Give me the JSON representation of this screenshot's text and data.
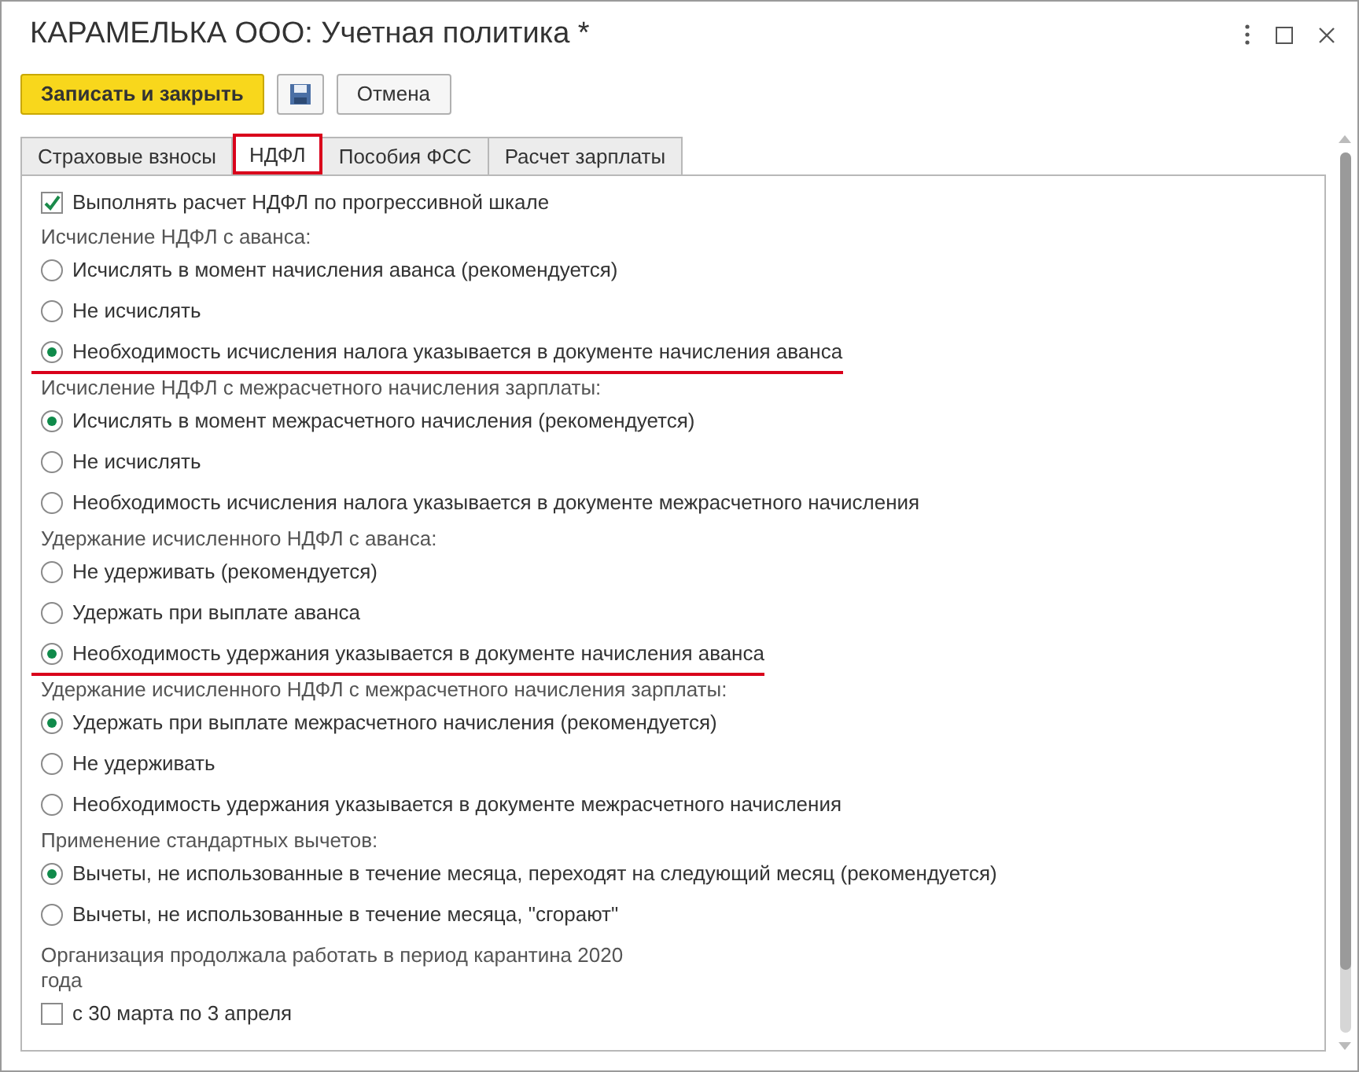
{
  "window": {
    "title": "КАРАМЕЛЬКА ООО: Учетная политика *"
  },
  "toolbar": {
    "primary_button": "Записать и закрыть",
    "cancel_button": "Отмена"
  },
  "tabs": [
    {
      "label": "Страховые взносы",
      "selected": false,
      "highlighted": false
    },
    {
      "label": "НДФЛ",
      "selected": true,
      "highlighted": true
    },
    {
      "label": "Пособия ФСС",
      "selected": false,
      "highlighted": false
    },
    {
      "label": "Расчет зарплаты",
      "selected": false,
      "highlighted": false
    }
  ],
  "content": [
    {
      "kind": "checkbox",
      "label": "Выполнять расчет НДФЛ по прогрессивной шкале",
      "checked": true
    },
    {
      "kind": "group",
      "heading": "Исчисление НДФЛ с аванса:",
      "options": [
        {
          "label": "Исчислять в момент начисления аванса (рекомендуется)",
          "selected": false,
          "underlined": false
        },
        {
          "label": "Не исчислять",
          "selected": false,
          "underlined": false
        },
        {
          "label": "Необходимость исчисления налога указывается в документе начисления аванса",
          "selected": true,
          "underlined": true
        }
      ]
    },
    {
      "kind": "group",
      "heading": "Исчисление НДФЛ с межрасчетного начисления зарплаты:",
      "options": [
        {
          "label": "Исчислять в момент межрасчетного начисления (рекомендуется)",
          "selected": true,
          "underlined": false
        },
        {
          "label": "Не исчислять",
          "selected": false,
          "underlined": false
        },
        {
          "label": "Необходимость исчисления налога указывается в документе межрасчетного начисления",
          "selected": false,
          "underlined": false
        }
      ]
    },
    {
      "kind": "group",
      "heading": "Удержание исчисленного НДФЛ с аванса:",
      "options": [
        {
          "label": "Не удерживать (рекомендуется)",
          "selected": false,
          "underlined": false
        },
        {
          "label": "Удержать при выплате аванса",
          "selected": false,
          "underlined": false
        },
        {
          "label": "Необходимость удержания указывается в документе начисления аванса",
          "selected": true,
          "underlined": true
        }
      ]
    },
    {
      "kind": "group",
      "heading": "Удержание исчисленного НДФЛ с межрасчетного начисления зарплаты:",
      "options": [
        {
          "label": "Удержать при выплате межрасчетного начисления (рекомендуется)",
          "selected": true,
          "underlined": false
        },
        {
          "label": "Не удерживать",
          "selected": false,
          "underlined": false
        },
        {
          "label": "Необходимость удержания указывается в документе межрасчетного начисления",
          "selected": false,
          "underlined": false
        }
      ]
    },
    {
      "kind": "group",
      "heading": "Применение стандартных вычетов:",
      "options": [
        {
          "label": "Вычеты, не использованные в течение месяца, переходят на следующий месяц (рекомендуется)",
          "selected": true,
          "underlined": false
        },
        {
          "label": "Вычеты, не использованные в течение месяца, \"сгорают\"",
          "selected": false,
          "underlined": false
        }
      ]
    },
    {
      "kind": "note",
      "text": "Организация продолжала работать в период карантина 2020 года"
    },
    {
      "kind": "checkbox",
      "label": "с 30 марта по 3 апреля",
      "checked": false
    }
  ]
}
